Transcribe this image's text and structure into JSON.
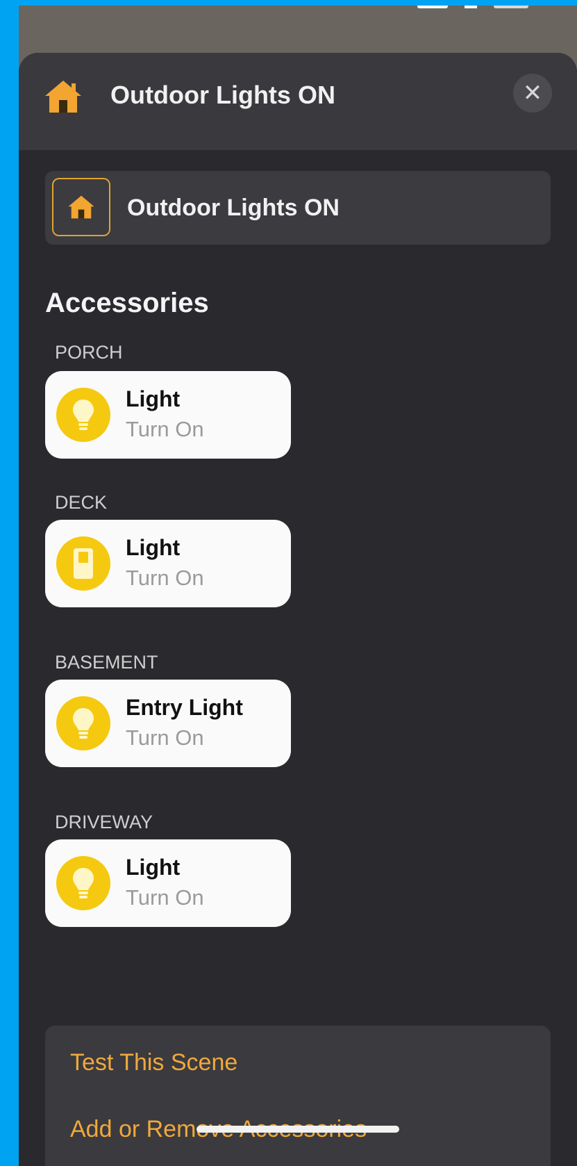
{
  "colors": {
    "accent": "#f0a93b",
    "icon_yellow": "#f5c90f",
    "sheet_bg": "#2a292e",
    "frame_bg": "#00a3f2"
  },
  "sheet": {
    "title": "Outdoor Lights ON",
    "close_label": "✕",
    "header_icon": "house-icon"
  },
  "scene_name": {
    "value": "Outdoor Lights ON",
    "icon": "house-icon"
  },
  "accessories": {
    "title": "Accessories",
    "rooms": [
      {
        "label": "PORCH",
        "name": "Light",
        "status": "Turn On",
        "icon": "lightbulb-icon"
      },
      {
        "label": "DECK",
        "name": "Light",
        "status": "Turn On",
        "icon": "light-switch-icon"
      },
      {
        "label": "BASEMENT",
        "name": "Entry Light",
        "status": "Turn On",
        "icon": "lightbulb-icon"
      },
      {
        "label": "DRIVEWAY",
        "name": "Light",
        "status": "Turn On",
        "icon": "lightbulb-icon"
      }
    ]
  },
  "actions": {
    "test_scene": "Test This Scene",
    "add_remove": "Add or Remove Accessories"
  }
}
